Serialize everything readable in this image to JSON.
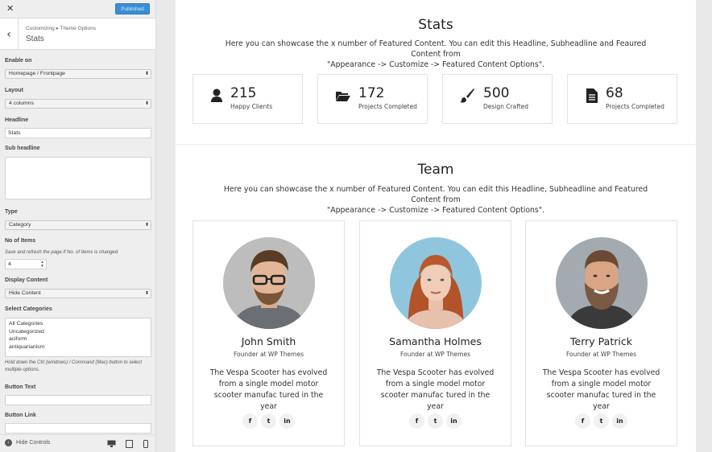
{
  "customizer": {
    "close_icon": "close-icon",
    "publish_label": "Published",
    "breadcrumb": "Customizing ▸ Theme Options",
    "section_title": "Stats",
    "enable_on": {
      "label": "Enable on",
      "value": "Homepage / Frontpage"
    },
    "layout": {
      "label": "Layout",
      "value": "4 columns"
    },
    "headline": {
      "label": "Headline",
      "value": "Stats"
    },
    "sub_headline": {
      "label": "Sub headline",
      "value": ""
    },
    "type": {
      "label": "Type",
      "value": "Category"
    },
    "no_of_items": {
      "label": "No of Items",
      "note": "Save and refresh the page if No. of Items is changed",
      "value": "4"
    },
    "display_content": {
      "label": "Display Content",
      "value": "Hide Content"
    },
    "select_categories": {
      "label": "Select Categories",
      "options": [
        "All Categories",
        "Uncategorized",
        "aciform",
        "antiquarianism"
      ],
      "note": "Hold down the Ctrl (windows) / Command (Mac) button to select multiple options."
    },
    "button_text": {
      "label": "Button Text",
      "value": ""
    },
    "button_link": {
      "label": "Button Link",
      "value": ""
    },
    "footer": {
      "hide_controls": "Hide Controls",
      "devices": [
        "desktop-icon",
        "tablet-icon",
        "mobile-icon"
      ]
    }
  },
  "stats": {
    "title": "Stats",
    "description_line1": "Here you can showcase the x number of Featured Content. You can edit this Headline, Subheadline and Feaured Content from",
    "description_line2": "\"Appearance -> Customize -> Featured Content Options\".",
    "items": [
      {
        "icon": "user-icon",
        "value": "215",
        "caption": "Happy Clients"
      },
      {
        "icon": "folder-open-icon",
        "value": "172",
        "caption": "Projects Completed"
      },
      {
        "icon": "paint-brush-icon",
        "value": "500",
        "caption": "Design Crafted"
      },
      {
        "icon": "document-icon",
        "value": "68",
        "caption": "Projects Completed"
      }
    ]
  },
  "team": {
    "title": "Team",
    "description_line1": "Here you can showcase the x number of Featured Content. You can edit this Headline, Subheadline and Featured Content from",
    "description_line2": "\"Appearance -> Customize -> Featured Content Options\".",
    "members": [
      {
        "name": "John Smith",
        "role": "Founder at WP Themes",
        "bio": "The Vespa Scooter has evolved from a single model motor scooter manufac tured in the year",
        "social": [
          "f",
          "t",
          "in"
        ]
      },
      {
        "name": "Samantha Holmes",
        "role": "Founder at WP Themes",
        "bio": "The Vespa Scooter has evolved from a single model motor scooter manufac tured in the year",
        "social": [
          "f",
          "t",
          "in"
        ]
      },
      {
        "name": "Terry Patrick",
        "role": "Founder at WP Themes",
        "bio": "The Vespa Scooter has evolved from a single model motor scooter manufac tured in the year",
        "social": [
          "f",
          "t",
          "in"
        ]
      }
    ]
  },
  "colors": {
    "publish_button": "#3a8ed6",
    "panel_bg": "#eeeeee",
    "card_border": "#e3e3e3"
  }
}
